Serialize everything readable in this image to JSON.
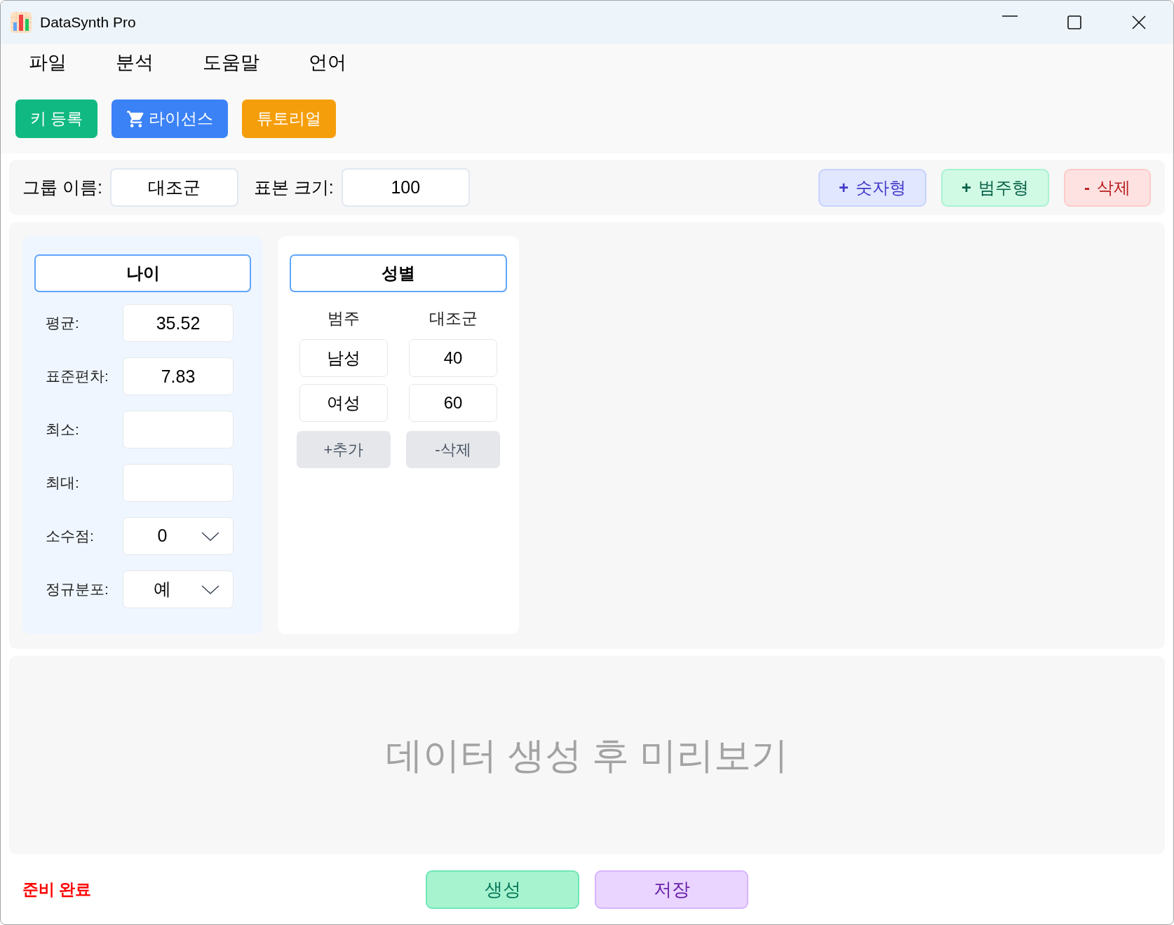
{
  "window": {
    "title": "DataSynth Pro"
  },
  "menu": [
    "파일",
    "분석",
    "도움말",
    "언어"
  ],
  "toolbar": [
    {
      "label": "키 등록",
      "color": "#10b981",
      "kind": "plain"
    },
    {
      "label": "라이선스",
      "color": "#3b82f6",
      "kind": "icon"
    },
    {
      "label": "튜토리얼",
      "color": "#f59e0b",
      "kind": "plain"
    }
  ],
  "group": {
    "name_label": "그룹 이름:",
    "name_value": "대조군",
    "size_label": "표본 크기:",
    "size_value": "100"
  },
  "actions": [
    {
      "kind": "numeric",
      "sign": "+",
      "label": "숫자형"
    },
    {
      "kind": "categorical",
      "sign": "+",
      "label": "범주형"
    },
    {
      "kind": "delete",
      "sign": "-",
      "label": "삭제"
    }
  ],
  "variables": [
    {
      "kind": "numeric",
      "name": "나이",
      "fields": [
        {
          "label": "평균:",
          "kind": "input",
          "value": "35.52"
        },
        {
          "label": "표준편차:",
          "kind": "input",
          "value": "7.83"
        },
        {
          "label": "최소:",
          "kind": "input"
        },
        {
          "label": "최대:",
          "kind": "input"
        },
        {
          "label": "소수점:",
          "kind": "select",
          "value": "0"
        },
        {
          "label": "정규분포:",
          "kind": "select",
          "value": "예"
        }
      ]
    },
    {
      "kind": "categorical",
      "name": "성별",
      "columns": [
        "범주",
        "대조군"
      ],
      "rows": [
        [
          "남성",
          "40"
        ],
        [
          "여성",
          "60"
        ]
      ],
      "buttons": [
        "+추가",
        "-삭제"
      ]
    }
  ],
  "preview": {
    "message": "데이터 생성 후 미리보기"
  },
  "status_bar": {
    "status": "준비 완료",
    "buttons": [
      {
        "kind": "generate",
        "label": "생성"
      },
      {
        "kind": "save",
        "label": "저장"
      }
    ]
  }
}
